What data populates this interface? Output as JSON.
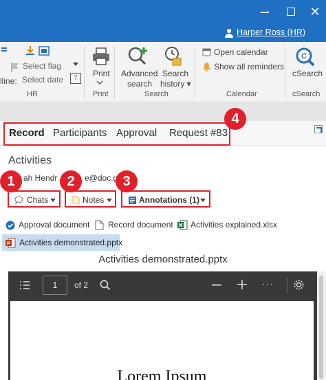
{
  "window": {
    "minimize_glyph": "",
    "close_glyph": "✕"
  },
  "userbar": {
    "user_name": "Harper Ross (HR)"
  },
  "ribbon": {
    "cut_left_label": "lline:",
    "select_flag": "Select flag",
    "select_date": "Select date",
    "group_hr": "HR",
    "print": "Print",
    "group_print": "Print",
    "advanced_search_line1": "Advanced",
    "advanced_search_line2": "search",
    "search_history_line1": "Search",
    "search_history_line2": "history ▾",
    "group_search": "Search",
    "open_calendar": "Open calendar",
    "show_all_reminders": "Show all reminders",
    "group_calendar": "Calendar",
    "csearch": "cSearch",
    "group_csearch": "cSearch",
    "calendar_day": "7"
  },
  "tabs": [
    {
      "label": "Record"
    },
    {
      "label": "Participants"
    },
    {
      "label": "Approval"
    },
    {
      "label": "Request #83"
    }
  ],
  "activities": {
    "title": "Activities",
    "email_fragment": "ah Hendr",
    "email_fragment_end": "e@doc.g"
  },
  "dropdowns": {
    "chats": "Chats",
    "notes": "Notes",
    "annotations": "Annotations (1)"
  },
  "badges": [
    "1",
    "2",
    "3",
    "4"
  ],
  "documents": [
    {
      "label": "Approval document"
    },
    {
      "label": "Record document"
    },
    {
      "label": "Activities explained.xlsx"
    }
  ],
  "active_document": "Activities demonstrated.pptx",
  "viewer": {
    "title": "Activities demonstrated.pptx",
    "page_number": "1",
    "page_of": "of 2",
    "page_text": "Lorem Ipsum",
    "more_glyph": "···"
  },
  "colors": {
    "titlebar": "#1f6fc3",
    "annotation_red": "#e0202a",
    "selected_doc": "#c7dcf0"
  }
}
